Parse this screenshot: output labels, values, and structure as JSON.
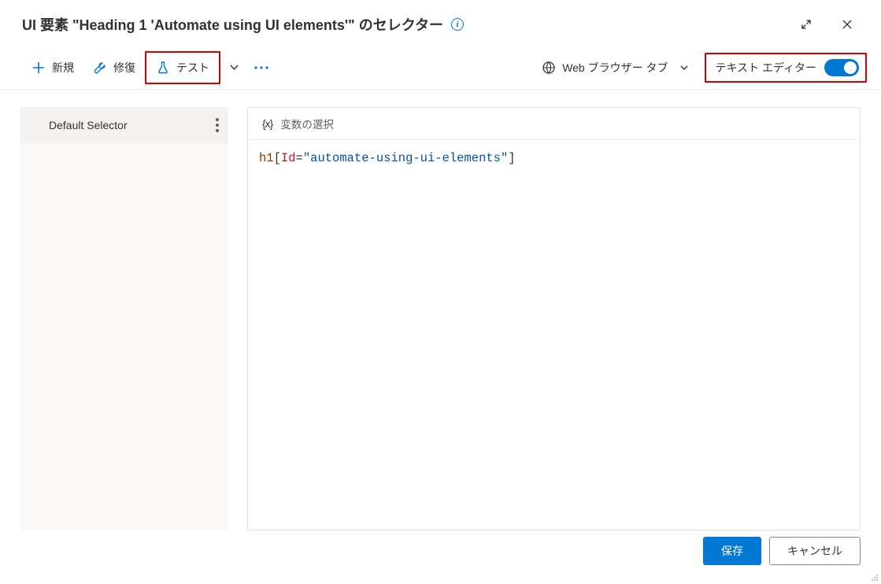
{
  "header": {
    "title": "UI 要素 \"Heading 1 'Automate using UI elements'\" のセレクター"
  },
  "toolbar": {
    "new_label": "新規",
    "repair_label": "修復",
    "test_label": "テスト",
    "browser_tab_label": "Web ブラウザー タブ",
    "text_editor_label": "テキスト エディター"
  },
  "sidebar": {
    "items": [
      {
        "label": "Default Selector"
      }
    ]
  },
  "editor": {
    "variable_select_label": "変数の選択",
    "code": {
      "tag": "h1",
      "open_bracket": "[",
      "attr": "Id",
      "eq": "=",
      "value": "\"automate-using-ui-elements\"",
      "close_bracket": "]"
    }
  },
  "footer": {
    "save_label": "保存",
    "cancel_label": "キャンセル"
  }
}
